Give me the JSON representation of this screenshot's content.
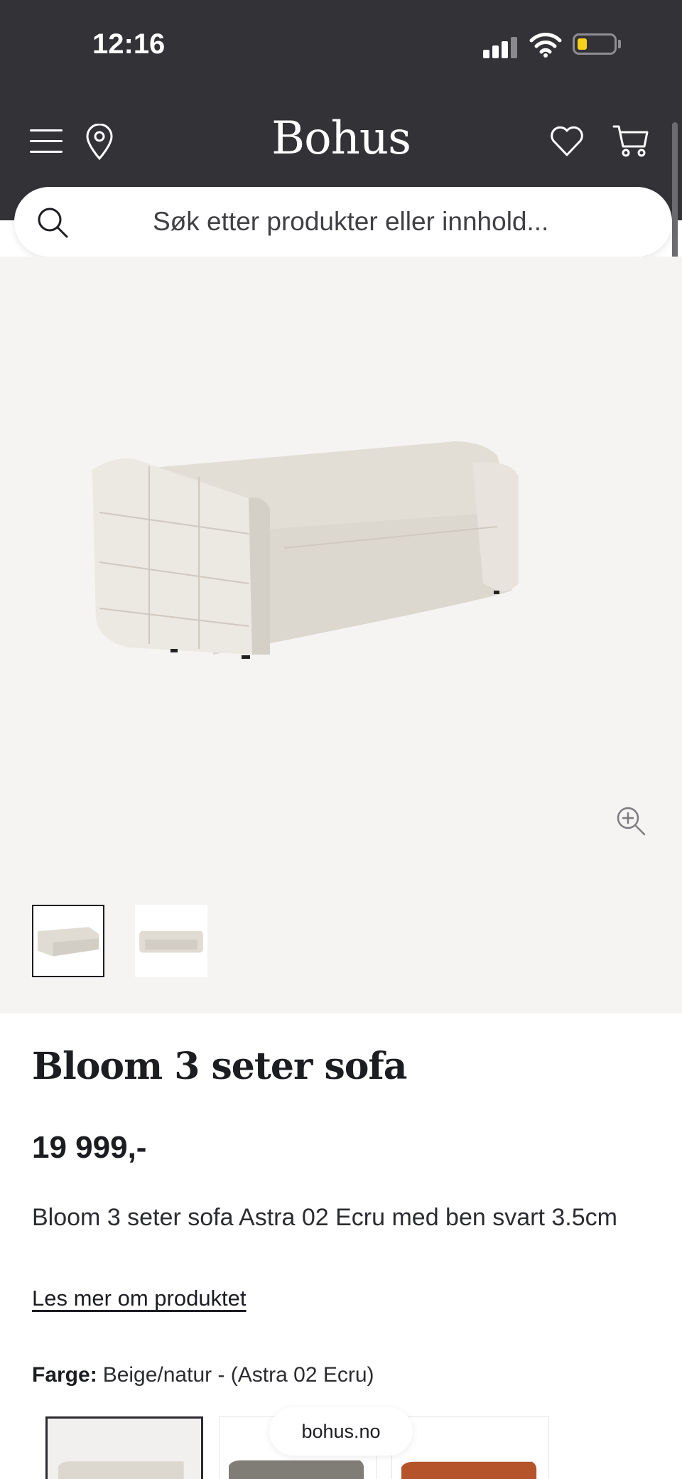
{
  "status_bar": {
    "time": "12:16",
    "icons": [
      "signal-icon",
      "wifi-icon",
      "battery-icon"
    ],
    "battery_color": "#f7d117"
  },
  "header": {
    "brand": "Bohus",
    "icons": [
      "menu-icon",
      "location-pin-icon",
      "heart-icon",
      "cart-icon"
    ],
    "background": "#333237"
  },
  "search": {
    "placeholder": "Søk etter produkter eller innhold...",
    "icon": "search-icon"
  },
  "gallery": {
    "zoom_icon": "zoom-in-icon",
    "thumbnails": [
      "sofa-angle-view",
      "sofa-front-view"
    ],
    "active_thumbnail": 0
  },
  "product": {
    "title": "Bloom 3 seter sofa",
    "price": "19 999,-",
    "description": "Bloom 3 seter sofa Astra 02 Ecru med ben svart 3.5cm",
    "read_more": "Les mer om produktet",
    "color_label": "Farge:",
    "color_value": "Beige/natur - (Astra 02 Ecru)",
    "swatches": [
      "beige",
      "grey",
      "cognac"
    ]
  },
  "footer": {
    "domain": "bohus.no"
  }
}
